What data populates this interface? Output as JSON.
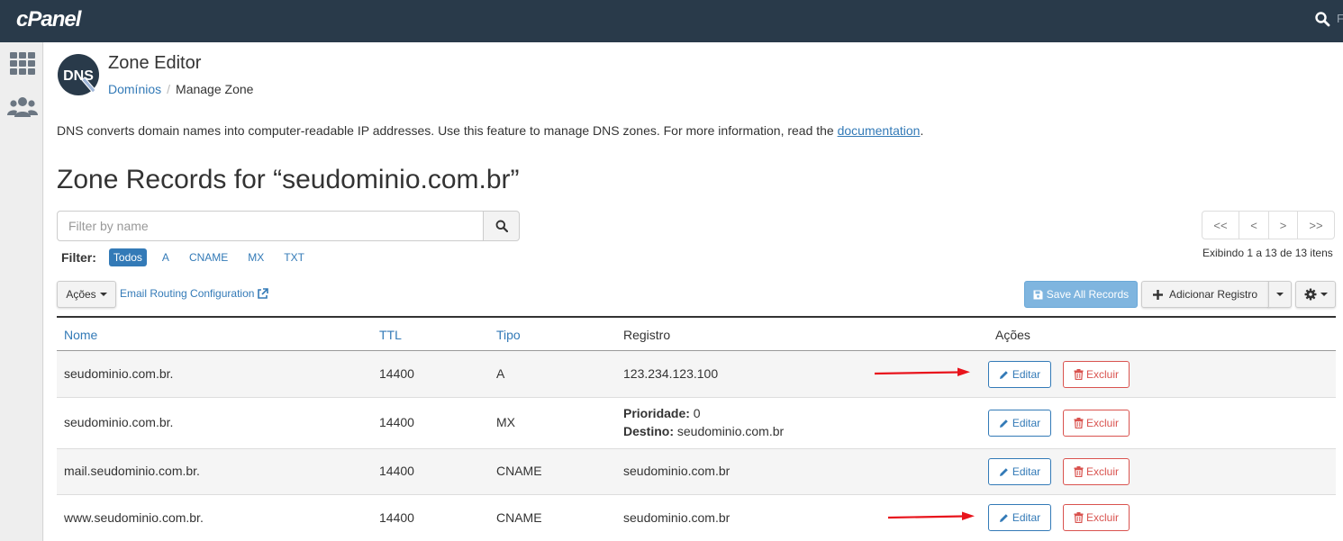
{
  "topbar": {
    "logo": "cPanel",
    "cut_letter": "F",
    "search_icon": "search-icon"
  },
  "leftbar": {
    "items": [
      {
        "icon": "grid-icon"
      },
      {
        "icon": "users-icon"
      }
    ]
  },
  "header": {
    "app_logo_text": "DNS",
    "title": "Zone Editor",
    "breadcrumb": {
      "parent": "Domínios",
      "separator": "/",
      "current": "Manage Zone"
    }
  },
  "description": {
    "text": "DNS converts domain names into computer-readable IP addresses. Use this feature to manage DNS zones. For more information, read the ",
    "link": "documentation",
    "end": "."
  },
  "zone_title": "Zone Records for “seudominio.com.br”",
  "filter": {
    "placeholder": "Filter by name",
    "label": "Filter:",
    "options": [
      "Todos",
      "A",
      "CNAME",
      "MX",
      "TXT"
    ],
    "active": "Todos"
  },
  "pagination": {
    "first": "<<",
    "prev": "<",
    "next": ">",
    "last": ">>",
    "showing": "Exibindo 1 a 13 de 13 itens"
  },
  "toolbar": {
    "acoes_label": "Ações",
    "email_routing": "Email Routing Configuration",
    "save_all": "Save All Records",
    "add_record": "Adicionar Registro"
  },
  "table": {
    "headers": {
      "name": "Nome",
      "ttl": "TTL",
      "type": "Tipo",
      "record": "Registro",
      "actions": "Ações"
    },
    "edit_label": "Editar",
    "delete_label": "Excluir",
    "rows": [
      {
        "name": "seudominio.com.br.",
        "ttl": "14400",
        "type": "A",
        "record": "123.234.123.100"
      },
      {
        "name": "seudominio.com.br.",
        "ttl": "14400",
        "type": "MX",
        "priority_label": "Prioridade:",
        "priority": " 0",
        "dest_label": "Destino:",
        "dest": " seudominio.com.br"
      },
      {
        "name": "mail.seudominio.com.br.",
        "ttl": "14400",
        "type": "CNAME",
        "record": "seudominio.com.br"
      },
      {
        "name": "www.seudominio.com.br.",
        "ttl": "14400",
        "type": "CNAME",
        "record": "seudominio.com.br"
      }
    ]
  },
  "colors": {
    "topbar": "#293a4a",
    "link": "#337ab7",
    "danger": "#d9534f",
    "annotation_arrow": "#e8141c"
  }
}
